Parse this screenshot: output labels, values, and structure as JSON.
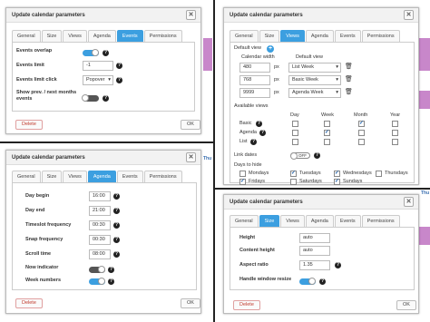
{
  "dialog_title": "Update calendar parameters",
  "tabs": [
    "General",
    "Size",
    "Views",
    "Agenda",
    "Events",
    "Permissions"
  ],
  "background": {
    "thu_label": "Thu"
  },
  "buttons": {
    "delete": "Delete",
    "ok": "OK"
  },
  "events_panel": {
    "events_overlap": {
      "label": "Events overlap",
      "on": true
    },
    "events_limit": {
      "label": "Events limit",
      "value": "-1"
    },
    "events_limit_click": {
      "label": "Events limit click",
      "value": "Popover"
    },
    "show_prev_next": {
      "label": "Show prev. / next months events",
      "on": false
    }
  },
  "views_panel": {
    "default_view_label": "Default view",
    "calendar_width_header": "Calendar width",
    "default_view_header": "Default view",
    "width_rows": [
      {
        "width": "480",
        "unit": "px",
        "view": "List Week"
      },
      {
        "width": "768",
        "unit": "px",
        "view": "Basic Week"
      },
      {
        "width": "9999",
        "unit": "px",
        "view": "Agenda Week"
      }
    ],
    "available_views_label": "Available views",
    "columns": [
      "Day",
      "Week",
      "Month",
      "Year"
    ],
    "view_rows": [
      {
        "label": "Basic",
        "checks": [
          false,
          false,
          true,
          false
        ]
      },
      {
        "label": "Agenda",
        "checks": [
          false,
          true,
          false,
          false
        ]
      },
      {
        "label": "List",
        "checks": [
          false,
          false,
          false,
          false
        ]
      }
    ],
    "link_dates": {
      "label": "Link dates",
      "state": "OFF"
    },
    "days_to_hide_label": "Days to hide",
    "days": [
      {
        "label": "Mondays",
        "checked": false
      },
      {
        "label": "Tuesdays",
        "checked": true
      },
      {
        "label": "Wednesdays",
        "checked": true
      },
      {
        "label": "Thursdays",
        "checked": false
      },
      {
        "label": "Fridays",
        "checked": true
      },
      {
        "label": "Saturdays",
        "checked": false
      },
      {
        "label": "Sundays",
        "checked": true
      }
    ]
  },
  "agenda_panel": {
    "day_begin": {
      "label": "Day begin",
      "value": "16:00"
    },
    "day_end": {
      "label": "Day end",
      "value": "21:00"
    },
    "timeslot_frequency": {
      "label": "Timeslot frequency",
      "value": "00:30"
    },
    "snap_frequency": {
      "label": "Snap frequency",
      "value": "00:30"
    },
    "scroll_time": {
      "label": "Scroll time",
      "value": "08:00"
    },
    "now_indicator": {
      "label": "Now indicator",
      "on": false
    },
    "week_numbers": {
      "label": "Week numbers",
      "on": true
    }
  },
  "size_panel": {
    "height": {
      "label": "Height",
      "value": "auto"
    },
    "content_height": {
      "label": "Content height",
      "value": "auto"
    },
    "aspect_ratio": {
      "label": "Aspect ratio",
      "value": "1.35"
    },
    "handle_window_resize": {
      "label": "Handle window resize",
      "on": true
    }
  },
  "colors": {
    "accent": "#3c9fe0",
    "stripe": "#b55fb8",
    "divider": "#222222"
  }
}
